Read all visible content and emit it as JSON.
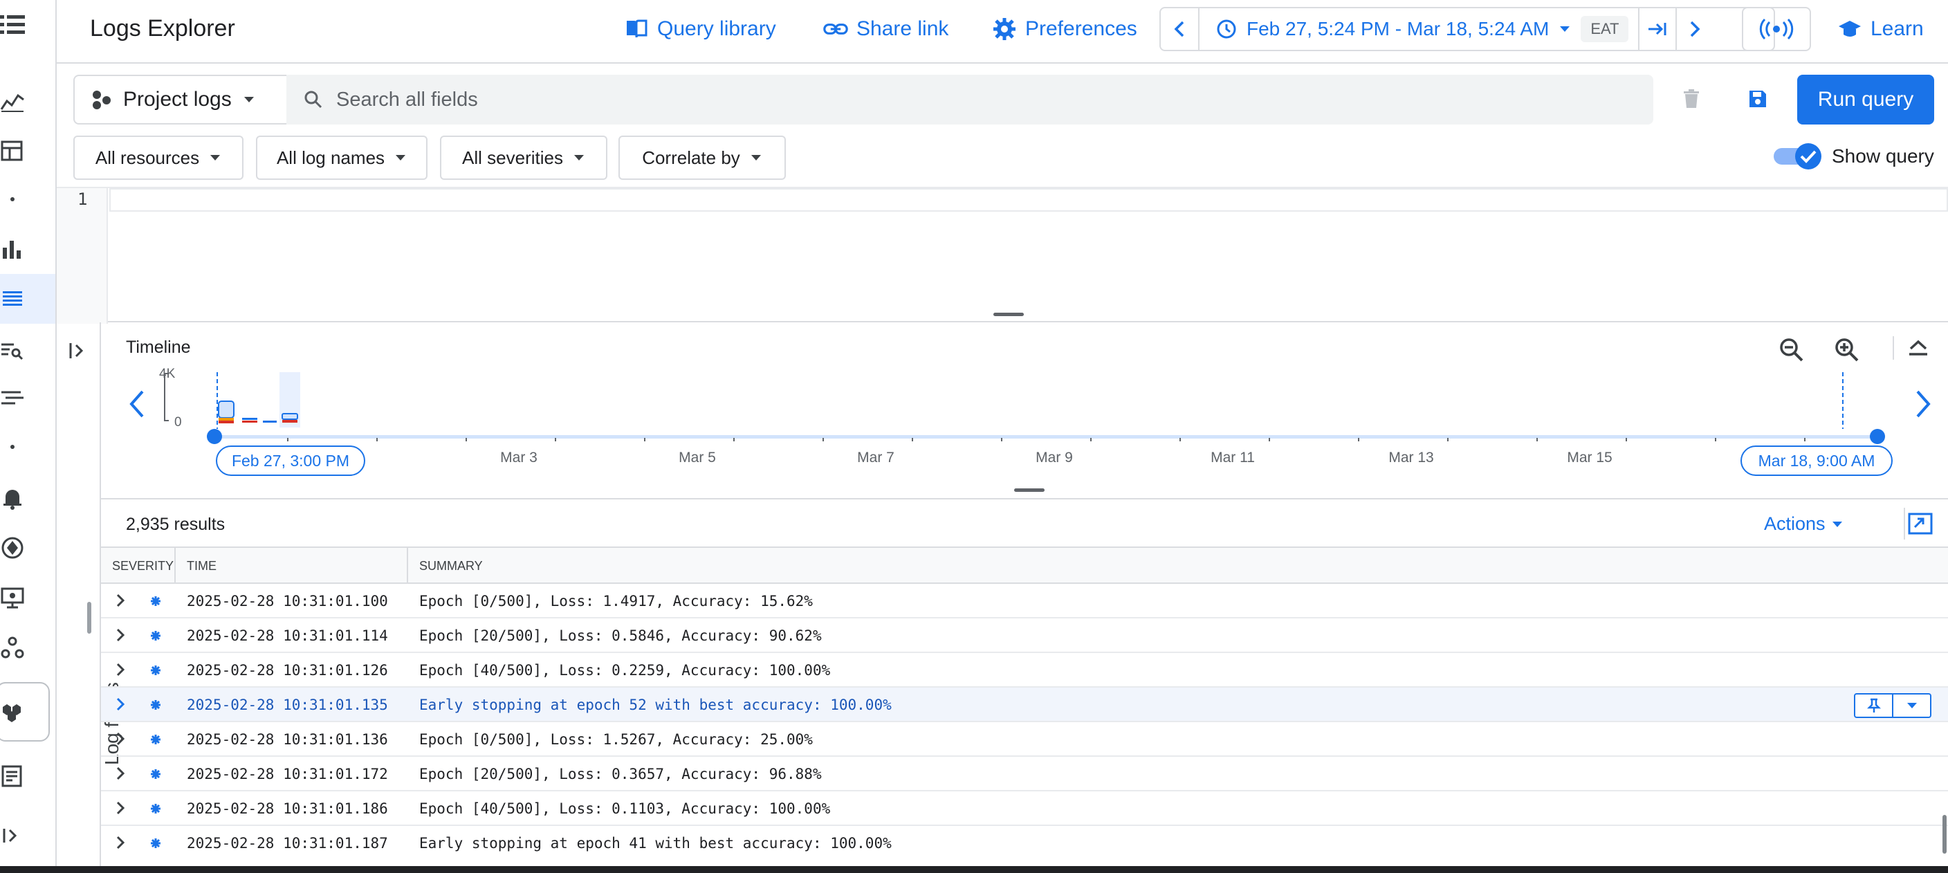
{
  "header": {
    "title": "Logs Explorer",
    "query_library_label": "Query library",
    "share_link_label": "Share link",
    "preferences_label": "Preferences",
    "time_range_label": "Feb 27, 5:24 PM - Mar 18, 5:24 AM",
    "timezone_label": "EAT",
    "learn_label": "Learn"
  },
  "query": {
    "project_label": "Project logs",
    "search_placeholder": "Search all fields",
    "run_label": "Run query",
    "filters": [
      "All resources",
      "All log names",
      "All severities",
      "Correlate by"
    ],
    "show_query_label": "Show query",
    "show_query_on": true,
    "line_number": "1"
  },
  "sidebar": {
    "log_fields_label": "Log fields"
  },
  "timeline": {
    "title": "Timeline",
    "y_max_label": "4K",
    "y_min_label": "0",
    "start_label": "Feb 27, 3:00 PM",
    "end_label": "Mar 18, 9:00 AM",
    "tick_labels": [
      "Mar 3",
      "Mar 5",
      "Mar 7",
      "Mar 9",
      "Mar 11",
      "Mar 13",
      "Mar 15"
    ]
  },
  "results": {
    "count_label": "2,935 results",
    "actions_label": "Actions",
    "columns": [
      "SEVERITY",
      "TIME",
      "SUMMARY"
    ],
    "rows": [
      {
        "time": "2025-02-28 10:31:01.100",
        "summary": "Epoch [0/500], Loss: 1.4917, Accuracy: 15.62%"
      },
      {
        "time": "2025-02-28 10:31:01.114",
        "summary": "Epoch [20/500], Loss: 0.5846, Accuracy: 90.62%"
      },
      {
        "time": "2025-02-28 10:31:01.126",
        "summary": "Epoch [40/500], Loss: 0.2259, Accuracy: 100.00%"
      },
      {
        "time": "2025-02-28 10:31:01.135",
        "summary": "Early stopping at epoch 52 with best accuracy: 100.00%"
      },
      {
        "time": "2025-02-28 10:31:01.136",
        "summary": "Epoch [0/500], Loss: 1.5267, Accuracy: 25.00%"
      },
      {
        "time": "2025-02-28 10:31:01.172",
        "summary": "Epoch [20/500], Loss: 0.3657, Accuracy: 96.88%"
      },
      {
        "time": "2025-02-28 10:31:01.186",
        "summary": "Epoch [40/500], Loss: 0.1103, Accuracy: 100.00%"
      },
      {
        "time": "2025-02-28 10:31:01.187",
        "summary": "Early stopping at epoch 41 with best accuracy: 100.00%"
      }
    ]
  },
  "colors": {
    "accent": "#1a73e8",
    "highlight_row": "#f1f5fc",
    "border": "#dadce0"
  }
}
